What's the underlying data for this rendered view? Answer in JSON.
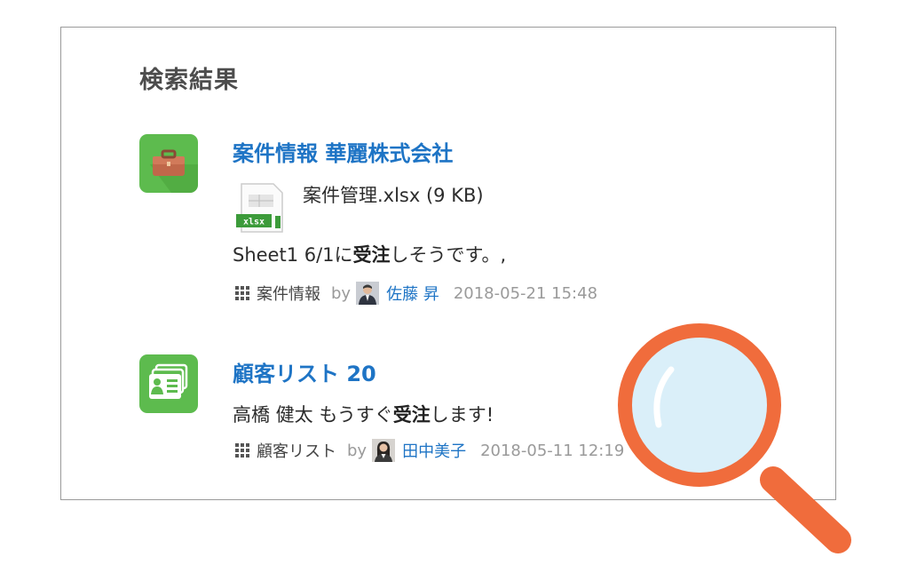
{
  "search": {
    "heading": "検索結果",
    "results": [
      {
        "title": "案件情報 華麗株式会社",
        "icon": "briefcase-icon",
        "attachment": {
          "icon": "xlsx-file-icon",
          "badge": "xlsx",
          "name": "案件管理.xlsx (9 KB)"
        },
        "snippet": {
          "prefix": "Sheet1 6/1に",
          "highlight": "受注",
          "suffix": "しそうです。,"
        },
        "meta": {
          "app": "案件情報",
          "by": "by",
          "user": "佐藤 昇",
          "date": "2018-05-21 15:48"
        }
      },
      {
        "title": "顧客リスト 20",
        "icon": "contact-card-icon",
        "snippet": {
          "prefix": "高橋 健太 もうすぐ",
          "highlight": "受注",
          "suffix": "します!"
        },
        "meta": {
          "app": "顧客リスト",
          "by": "by",
          "user": "田中美子",
          "date": "2018-05-11 12:19"
        }
      }
    ]
  },
  "colors": {
    "link": "#1e74c5",
    "icon_green": "#5dbb4e",
    "magnifier": "#f06c3c",
    "lens": "#d7eef9"
  }
}
